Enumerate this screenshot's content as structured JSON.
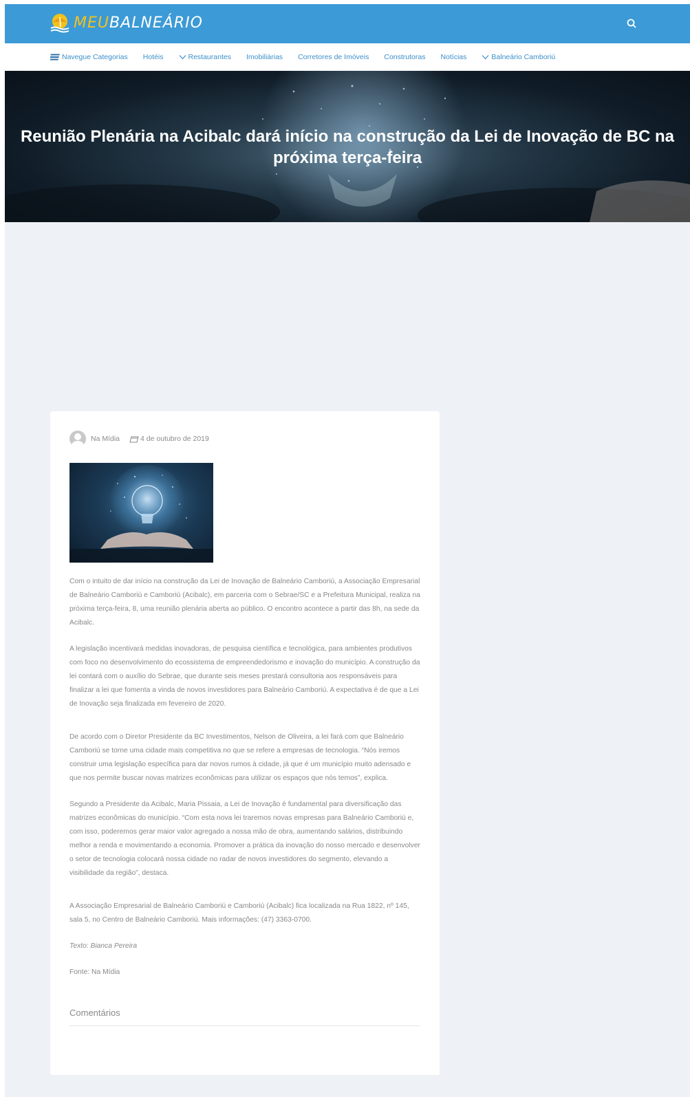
{
  "header": {
    "logo_meu": "MEU",
    "logo_balneario": "BALNEÁRIO",
    "search_icon": "search-icon",
    "brand_color": "#3c9ad6"
  },
  "nav": {
    "items": [
      {
        "label": "Navegue Categorias",
        "icon": "menu-icon"
      },
      {
        "label": "Hotéis"
      },
      {
        "label": "Restaurantes",
        "icon": "chevron-down-icon"
      },
      {
        "label": "Imobiliárias"
      },
      {
        "label": "Corretores de Imóveis"
      },
      {
        "label": "Construtoras"
      },
      {
        "label": "Notícias"
      },
      {
        "label": "Balneário Camboriú",
        "icon": "chevron-down-icon"
      }
    ]
  },
  "hero": {
    "title": "Reunião Plenária na Acibalc dará início na construção da Lei de Inovação de BC na próxima terça-feira"
  },
  "post": {
    "author": "Na Mídia",
    "date": "4 de outubro de 2019",
    "paragraphs": [
      "Com o intuito de dar início na construção da Lei de Inovação de Balneário Camboriú, a Associação Empresarial de Balneário Camboriú e Camboriú (Acibalc), em parceria com o Sebrae/SC e a Prefeitura Municipal, realiza na próxima terça-feira, 8, uma reunião plenária aberta ao público. O encontro acontece a partir das 8h, na sede da Acibalc.",
      "A legislação incentivará medidas inovadoras, de pesquisa científica e tecnológica, para ambientes produtivos com foco no desenvolvimento do ecossistema de empreendedorismo e inovação do município. A construção da lei contará com o auxílio do Sebrae, que durante seis meses prestará consultoria aos responsáveis para finalizar a lei que fomenta a vinda de novos investidores para Balneário Camboriú. A expectativa é de que a Lei de Inovação seja finalizada em fevereiro de 2020.",
      "De acordo com o Diretor Presidente da BC Investimentos, Nelson de Oliveira, a lei fará com que Balneário Camboriú se torne uma cidade mais competitiva no que se refere a empresas de tecnologia. “Nós iremos construir uma legislação específica para dar novos rumos à cidade, já que é um município muito adensado e que nos permite buscar novas matrizes econômicas para utilizar os espaços que nós temos”, explica.",
      "Segundo a Presidente da Acibalc, Maria Pissaia, a Lei de Inovação é fundamental para diversificação das matrizes econômicas do município. “Com esta nova lei traremos novas empresas para Balneário Camboriú e, com isso, poderemos gerar maior valor agregado a nossa mão de obra, aumentando salários, distribuindo melhor a renda e movimentando a economia. Promover a prática da inovação do nosso mercado e desenvolver o setor de tecnologia colocará nossa cidade no radar de novos investidores do segmento, elevando a visibilidade da região”, destaca.",
      "A Associação Empresarial de Balneário Camboriú e Camboriú (Acibalc) fica localizada na Rua 1822, nº 145, sala 5, no Centro de Balneário Camboriú. Mais informações: (47) 3363-0700."
    ],
    "credit": "Texto: Bianca Pereira",
    "source": "Fonte: Na Mídia",
    "comments_title": "Comentários"
  }
}
